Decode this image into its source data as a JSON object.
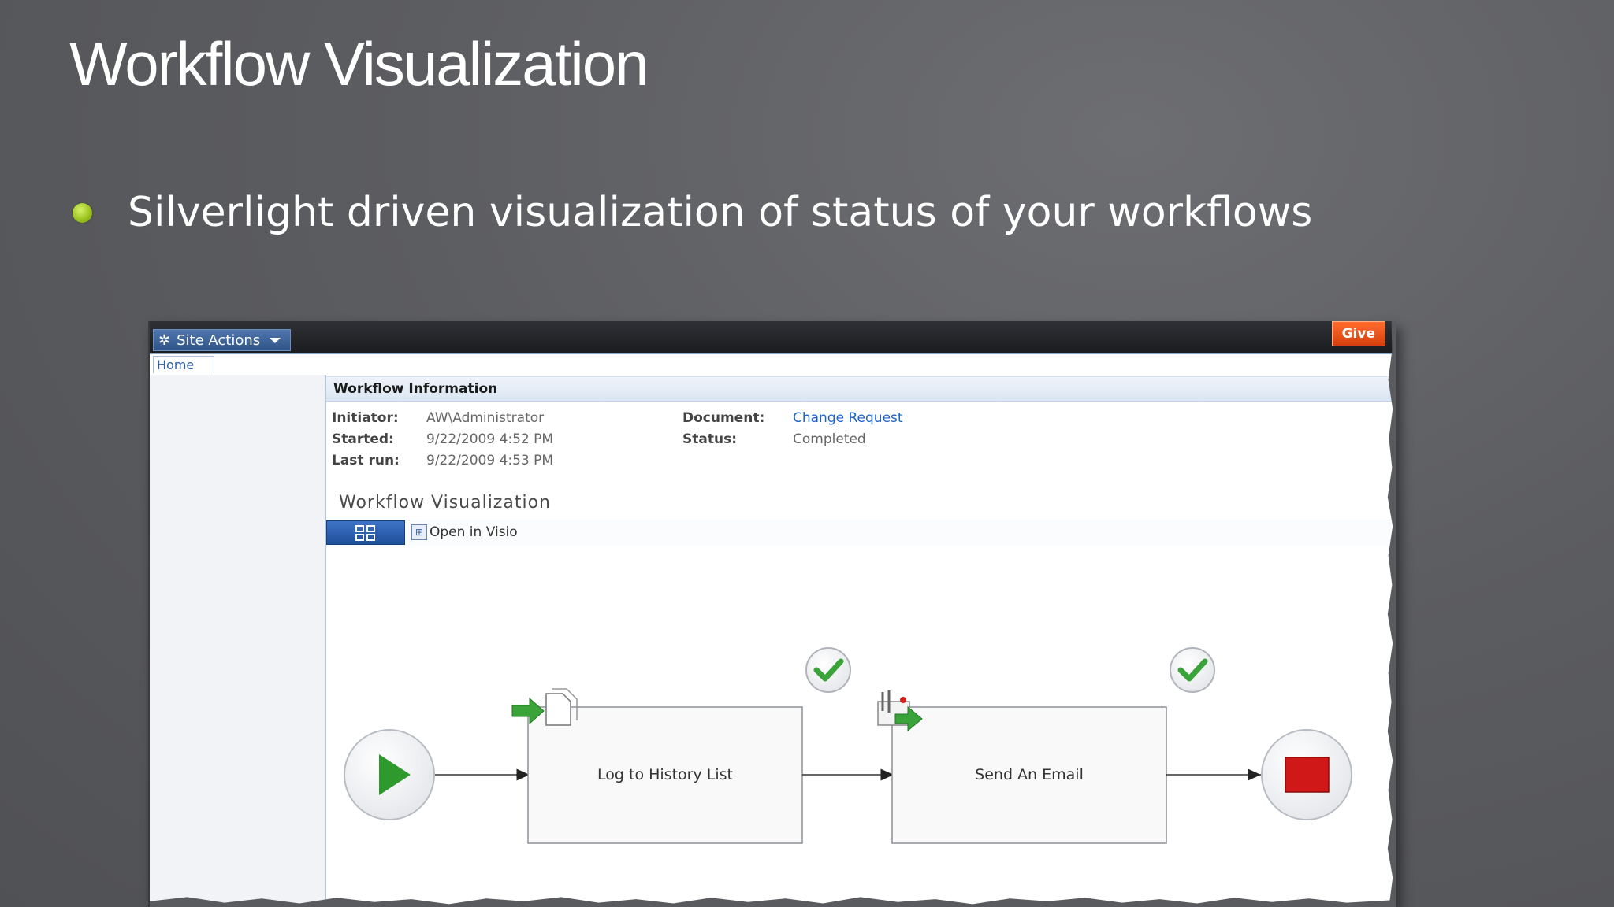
{
  "slide": {
    "title": "Workflow Visualization",
    "bullet": "Silverlight driven visualization of status of your workflows"
  },
  "sharepoint": {
    "site_actions_label": "Site Actions",
    "give_label": "Give",
    "home_tab": "Home",
    "section_title": "Workflow Information",
    "initiator_label": "Initiator:",
    "initiator_value": "AW\\Administrator",
    "started_label": "Started:",
    "started_value": "9/22/2009 4:52 PM",
    "last_run_label": "Last run:",
    "last_run_value": "9/22/2009 4:53 PM",
    "document_label": "Document:",
    "document_value": "Change Request",
    "status_label": "Status:",
    "status_value": "Completed",
    "viz_heading": "Workflow Visualization",
    "open_in_visio": "Open in Visio"
  },
  "workflow": {
    "steps": [
      {
        "label": "Log to History List",
        "status": "completed",
        "icon": "document-arrow-icon"
      },
      {
        "label": "Send An Email",
        "status": "completed",
        "icon": "email-arrow-icon"
      }
    ],
    "start_icon": "play-icon",
    "end_icon": "stop-icon",
    "colors": {
      "check": "#3aa33a",
      "play": "#2e9a2e",
      "stop": "#d01818",
      "accent": "#9cc51f"
    }
  }
}
